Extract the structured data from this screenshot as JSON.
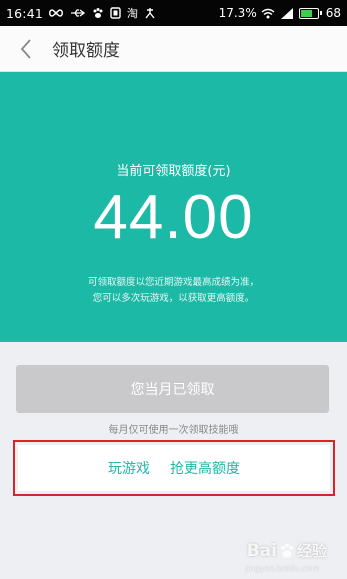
{
  "status_bar": {
    "time": "16:41",
    "icons": [
      "infinity-icon",
      "usb-icon",
      "paw-icon",
      "notification-icon",
      "taobao-icon",
      "tool-icon"
    ],
    "taobao_glyph": "淘",
    "battery_percent": "17.3%",
    "signal_icons": [
      "wifi-icon",
      "signal-icon"
    ],
    "battery_level": "68"
  },
  "header": {
    "title": "领取额度"
  },
  "hero": {
    "label": "当前可领取额度(元)",
    "amount": "44.00",
    "note_line1": "可领取额度以您近期游戏最高成绩为准，",
    "note_line2": "您可以多次玩游戏，以获取更高额度。"
  },
  "claim": {
    "button_label": "您当月已领取",
    "hint": "每月仅可使用一次领取技能哦"
  },
  "actions": {
    "play_game": "玩游戏",
    "get_higher": "抢更高额度"
  },
  "watermark": {
    "brand": "Bai",
    "brand_suffix": "经验",
    "url": "jingyan.baidu.com"
  },
  "colors": {
    "accent": "#1db9a7",
    "link": "#1fb8a6",
    "highlight": "#d9252a",
    "disabled_button": "#c9c9cc"
  }
}
